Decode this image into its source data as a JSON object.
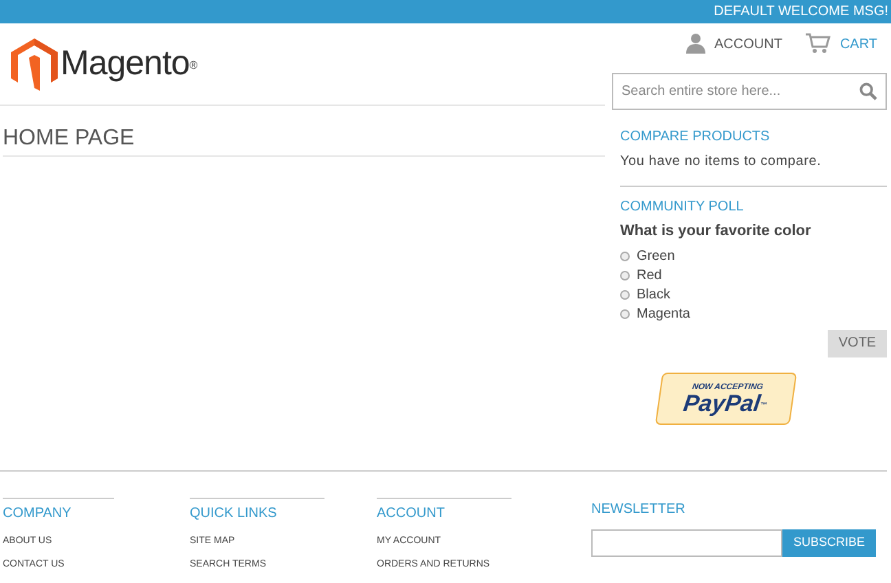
{
  "top_bar": {
    "welcome": "DEFAULT WELCOME MSG!"
  },
  "header": {
    "logo_text": "Magento",
    "logo_mark": "®",
    "links": [
      {
        "kind": "account",
        "label": "ACCOUNT"
      },
      {
        "kind": "cart",
        "label": "CART"
      }
    ],
    "search": {
      "placeholder": "Search entire store here..."
    }
  },
  "main": {
    "title": "HOME PAGE"
  },
  "sidebar": {
    "compare": {
      "title": "COMPARE PRODUCTS",
      "text": "You have no items to compare."
    },
    "poll": {
      "title": "COMMUNITY POLL",
      "question": "What is your favorite color",
      "options": [
        {
          "label": "Green",
          "selected": false
        },
        {
          "label": "Red",
          "selected": false
        },
        {
          "label": "Black",
          "selected": false
        },
        {
          "label": "Magenta",
          "selected": false
        }
      ],
      "button": "VOTE"
    },
    "paypal": {
      "line1": "NOW ACCEPTING",
      "line2": "PayPal",
      "mark": "™"
    }
  },
  "footer": {
    "columns": [
      {
        "title": "COMPANY",
        "links": [
          "ABOUT US",
          "CONTACT US"
        ]
      },
      {
        "title": "QUICK LINKS",
        "links": [
          "SITE MAP",
          "SEARCH TERMS"
        ]
      },
      {
        "title": "ACCOUNT",
        "links": [
          "MY ACCOUNT",
          "ORDERS AND RETURNS"
        ]
      }
    ],
    "newsletter": {
      "title": "NEWSLETTER",
      "button": "SUBSCRIBE"
    }
  }
}
